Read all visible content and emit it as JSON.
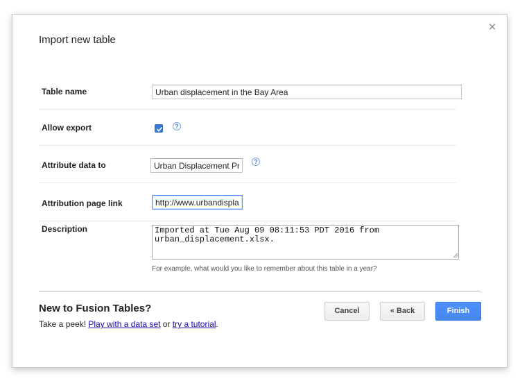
{
  "dialog": {
    "title": "Import new table",
    "close_symbol": "×"
  },
  "form": {
    "table_name": {
      "label": "Table name",
      "value": "Urban displacement in the Bay Area"
    },
    "allow_export": {
      "label": "Allow export",
      "checked": true
    },
    "attribute_data": {
      "label": "Attribute data to",
      "value": "Urban Displacement Pro"
    },
    "attribution_link": {
      "label": "Attribution page link",
      "value": "http://www.urbandisplac"
    },
    "description": {
      "label": "Description",
      "value": "Imported at Tue Aug 09 08:11:53 PDT 2016 from urban_displacement.xlsx.",
      "hint": "For example, what would you like to remember about this table in a year?"
    }
  },
  "help": {
    "glyph": "?"
  },
  "promo": {
    "title": "New to Fusion Tables?",
    "lead": "Take a peek! ",
    "link1": "Play with a data set",
    "mid": " or ",
    "link2": "try a tutorial",
    "tail": "."
  },
  "buttons": {
    "cancel": "Cancel",
    "back": "« Back",
    "finish": "Finish"
  },
  "colors": {
    "accent": "#4d90fe",
    "link": "#1a0dab",
    "checkbox": "#3a7bd5"
  }
}
